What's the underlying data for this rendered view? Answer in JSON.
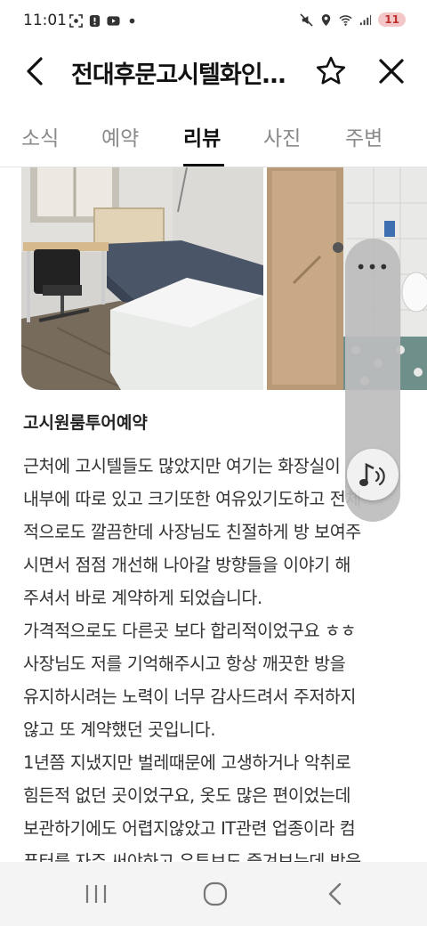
{
  "status_bar": {
    "time": "11:01",
    "battery_level": "11",
    "icons": [
      "screenshot-icon",
      "alert-icon",
      "youtube-icon",
      "dot-icon",
      "mute-icon",
      "location-icon",
      "wifi-icon",
      "signal-icon"
    ]
  },
  "header": {
    "title": "전대후문고시텔화인…",
    "back_icon": "back-arrow-icon",
    "star_icon": "star-icon",
    "close_icon": "close-icon"
  },
  "tabs": [
    {
      "label": "소식",
      "active": false
    },
    {
      "label": "예약",
      "active": false
    },
    {
      "label": "리뷰",
      "active": true
    },
    {
      "label": "사진",
      "active": false
    },
    {
      "label": "주변",
      "active": false
    }
  ],
  "review": {
    "title": "고시원룸투어예약",
    "lines": [
      "근처에 고시텔들도 많았지만 여기는 화장실이",
      "내부에 따로 있고 크기또한 여유있기도하고 전체",
      "적으로도 깔끔한데 사장님도 친절하게 방 보여주",
      "시면서 점점 개선해 나아갈 방향들을 이야기 해",
      "주셔서 바로 계약하게 되었습니다.",
      "가격적으로도 다른곳 보다 합리적이었구요 ㅎㅎ",
      "사장님도 저를 기억해주시고 항상 깨끗한 방을",
      "유지하시려는 노력이 너무 감사드려서 주저하지",
      "않고 또 계약했던 곳입니다.",
      "1년쯤 지냈지만 벌레때문에 고생하거나 악취로",
      "힘든적 없던 곳이었구요, 옷도 많은 편이었는데",
      "보관하기에도 어렵지않았고 IT관련 업종이라 컴",
      "퓨터를 자주 써야하고 유튜브도 즐겨보는데 방음"
    ]
  },
  "floating_widget": {
    "menu_label": "•••",
    "music_icon": "music-note-icon"
  },
  "nav_bar": {
    "recent_icon": "recent-apps-icon",
    "home_icon": "home-icon",
    "back_icon": "nav-back-icon"
  },
  "colors": {
    "active_tab": "#111111",
    "inactive_tab": "#8a8a8a",
    "battery_badge_bg": "#f3c7c7",
    "battery_badge_text": "#c03030"
  }
}
